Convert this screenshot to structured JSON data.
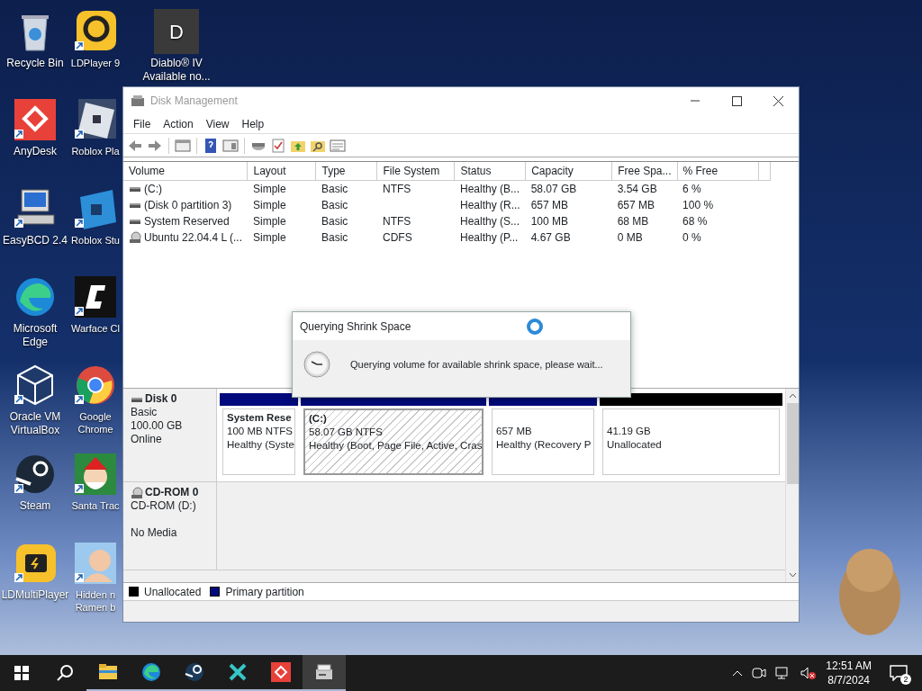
{
  "desktop_icons": [
    {
      "label": "Recycle Bin"
    },
    {
      "label": "LDPlayer 9"
    },
    {
      "label": "Diablo® IV Available no...",
      "tile_letter": "D"
    },
    {
      "label": "AnyDesk"
    },
    {
      "label": "Roblox Pla"
    },
    {
      "label": "EasyBCD 2.4"
    },
    {
      "label": "Roblox Stu"
    },
    {
      "label": "Microsoft Edge"
    },
    {
      "label": "Warface Cl"
    },
    {
      "label": "Oracle VM VirtualBox"
    },
    {
      "label": "Google Chrome"
    },
    {
      "label": "Steam"
    },
    {
      "label": "Santa Trac"
    },
    {
      "label": "LDMultiPlayer"
    },
    {
      "label": "Hidden n Ramen b"
    }
  ],
  "window": {
    "title": "Disk Management",
    "menu": [
      "File",
      "Action",
      "View",
      "Help"
    ],
    "table": {
      "columns": [
        "Volume",
        "Layout",
        "Type",
        "File System",
        "Status",
        "Capacity",
        "Free Spa...",
        "% Free"
      ],
      "rows": [
        {
          "kind": "disk",
          "cells": [
            "(C:)",
            "Simple",
            "Basic",
            "NTFS",
            "Healthy (B...",
            "58.07 GB",
            "3.54 GB",
            "6 %"
          ]
        },
        {
          "kind": "disk",
          "cells": [
            "(Disk 0 partition 3)",
            "Simple",
            "Basic",
            "",
            "Healthy (R...",
            "657 MB",
            "657 MB",
            "100 %"
          ]
        },
        {
          "kind": "disk",
          "cells": [
            "System Reserved",
            "Simple",
            "Basic",
            "NTFS",
            "Healthy (S...",
            "100 MB",
            "68 MB",
            "68 %"
          ]
        },
        {
          "kind": "cdrom",
          "cells": [
            "Ubuntu 22.04.4 L (...",
            "Simple",
            "Basic",
            "CDFS",
            "Healthy (P...",
            "4.67 GB",
            "0 MB",
            "0 %"
          ]
        }
      ]
    },
    "disks": [
      {
        "kind": "disk",
        "name": "Disk 0",
        "type": "Basic",
        "size": "100.00 GB",
        "status": "Online",
        "partitions": [
          {
            "kind": "primary",
            "selected": false,
            "title": "System Rese",
            "size": "100 MB NTFS",
            "status": "Healthy (Syste"
          },
          {
            "kind": "primary",
            "selected": true,
            "title": "(C:)",
            "size": "58.07 GB NTFS",
            "status": "Healthy (Boot, Page File, Active, Cras"
          },
          {
            "kind": "primary",
            "selected": false,
            "size": "657 MB",
            "status": "Healthy (Recovery P"
          },
          {
            "kind": "unallocated",
            "selected": false,
            "size": "41.19 GB",
            "status": "Unallocated"
          }
        ]
      },
      {
        "kind": "cdrom",
        "name": "CD-ROM 0",
        "type": "CD-ROM (D:)",
        "status": "No Media"
      }
    ],
    "legend": [
      {
        "kind": "unallocated",
        "label": "Unallocated"
      },
      {
        "kind": "primary",
        "label": "Primary partition"
      }
    ]
  },
  "dialog": {
    "title": "Querying Shrink Space",
    "message": "Querying volume for available shrink space, please wait..."
  },
  "taskbar": {
    "apps": [
      {
        "running": true,
        "selected": false
      },
      {
        "running": true,
        "selected": false
      },
      {
        "running": true,
        "selected": false
      },
      {
        "running": true,
        "selected": false
      },
      {
        "running": true,
        "selected": false
      },
      {
        "running": true,
        "selected": true
      }
    ],
    "time": "12:51 AM",
    "date": "8/7/2024",
    "notifications": "2"
  }
}
